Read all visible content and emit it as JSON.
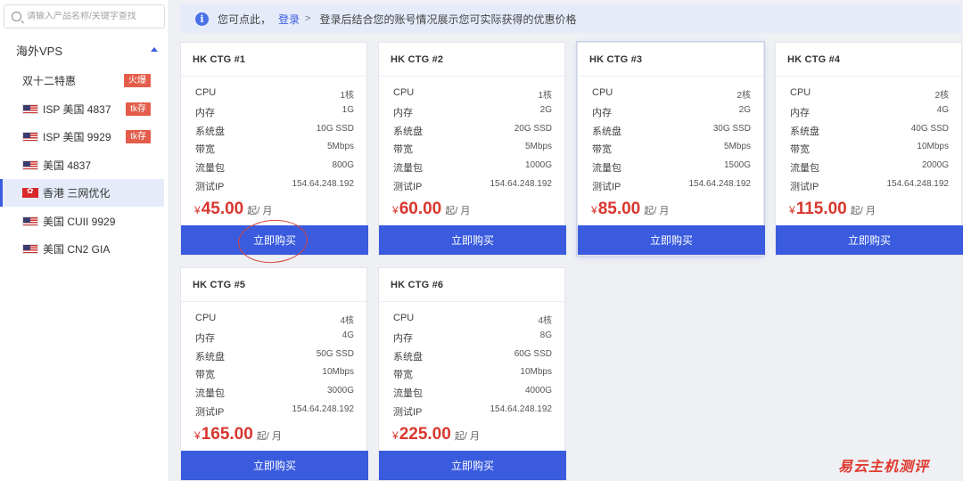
{
  "search": {
    "placeholder": "请输入产品名称/关键字查找"
  },
  "sidebar": {
    "group_title": "海外VPS",
    "items": [
      {
        "label": "双十二特惠",
        "flag": "",
        "badge": "火爆",
        "active": false
      },
      {
        "label": "ISP 美国 4837",
        "flag": "us",
        "badge": "tk存",
        "active": false
      },
      {
        "label": "ISP 美国 9929",
        "flag": "us",
        "badge": "tk存",
        "active": false
      },
      {
        "label": "美国 4837",
        "flag": "us",
        "badge": "",
        "active": false
      },
      {
        "label": "香港 三网优化",
        "flag": "hk",
        "badge": "",
        "active": true
      },
      {
        "label": "美国 CUII 9929",
        "flag": "us",
        "badge": "",
        "active": false
      },
      {
        "label": "美国 CN2 GIA",
        "flag": "us",
        "badge": "",
        "active": false
      }
    ]
  },
  "notice": {
    "prefix": "您可点此，",
    "login_link": "登录",
    "separator": ">",
    "suffix": "登录后结合您的账号情况展示您可实际获得的优惠价格"
  },
  "spec_labels": [
    "CPU",
    "内存",
    "系统盘",
    "带宽",
    "流量包",
    "测试IP"
  ],
  "currency": "¥",
  "price_unit": "起/ 月",
  "buy_label": "立即购买",
  "products": [
    {
      "name": "HK CTG #1",
      "specs": [
        "1核",
        "1G",
        "10G SSD",
        "5Mbps",
        "800G",
        "154.64.248.192"
      ],
      "price": "45.00"
    },
    {
      "name": "HK CTG #2",
      "specs": [
        "1核",
        "2G",
        "20G SSD",
        "5Mbps",
        "1000G",
        "154.64.248.192"
      ],
      "price": "60.00"
    },
    {
      "name": "HK CTG #3",
      "specs": [
        "2核",
        "2G",
        "30G SSD",
        "5Mbps",
        "1500G",
        "154.64.248.192"
      ],
      "price": "85.00"
    },
    {
      "name": "HK CTG #4",
      "specs": [
        "2核",
        "4G",
        "40G SSD",
        "10Mbps",
        "2000G",
        "154.64.248.192"
      ],
      "price": "115.00"
    },
    {
      "name": "HK CTG #5",
      "specs": [
        "4核",
        "4G",
        "50G SSD",
        "10Mbps",
        "3000G",
        "154.64.248.192"
      ],
      "price": "165.00"
    },
    {
      "name": "HK CTG #6",
      "specs": [
        "4核",
        "8G",
        "60G SSD",
        "10Mbps",
        "4000G",
        "154.64.248.192"
      ],
      "price": "225.00"
    }
  ],
  "watermark": "易云主机测评",
  "colors": {
    "accent": "#3a5bde",
    "price": "#d8372f",
    "badge": "#e35d4a",
    "annotation": "#d9433a"
  }
}
